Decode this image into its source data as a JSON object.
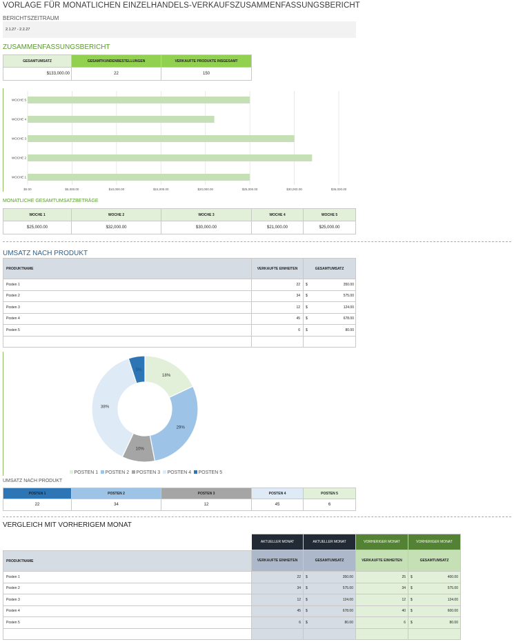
{
  "title": "VORLAGE FÜR MONATLICHEN EINZELHANDELS-VERKAUFSZUSAMMENFASSUNGSBERICHT",
  "period": {
    "label": "BERICHTSZEITRAUM",
    "value": "2.1.27 - 2.2.27"
  },
  "summary": {
    "heading": "ZUSAMMENFASSUNGSBERICHT",
    "headers": [
      "GESAMTUMSATZ",
      "GESAMTKUNDENBESTELLUNGEN",
      "VERKAUFTE PRODUKTE INSGESAMT"
    ],
    "values": [
      "$133,000.00",
      "22",
      "150"
    ]
  },
  "weekly": {
    "heading": "MONATLICHE GESAMTUMSATZBETRÄGE",
    "headers": [
      "WOCHE 1",
      "WOCHE 2",
      "WOCHE 3",
      "WOCHE 4",
      "WOCHE 5"
    ],
    "values": [
      "$25,000.00",
      "$32,000.00",
      "$30,000.00",
      "$21,000.00",
      "$25,000.00"
    ]
  },
  "product": {
    "heading": "UMSATZ NACH PRODUKT",
    "col_name": "PRODUKTNAME",
    "col_units": "VERKAUFTE EINHEITEN",
    "col_total": "GESAMTUMSATZ",
    "currency": "$",
    "rows": [
      {
        "name": "Posten 1",
        "units": "22",
        "total": "350.00"
      },
      {
        "name": "Posten 2",
        "units": "34",
        "total": "575.00"
      },
      {
        "name": "Posten 3",
        "units": "12",
        "total": "124.00"
      },
      {
        "name": "Posten 4",
        "units": "45",
        "total": "678.00"
      },
      {
        "name": "Posten 5",
        "units": "6",
        "total": "80.00"
      }
    ]
  },
  "units_table": {
    "heading": "UMSATZ NACH PRODUKT",
    "headers": [
      "POSTEN 1",
      "POSTEN 2",
      "POSTEN 3",
      "POSTEN 4",
      "POSTEN 5"
    ],
    "values": [
      "22",
      "34",
      "12",
      "45",
      "6"
    ]
  },
  "comparison": {
    "heading": "VERGLEICH MIT VORHERIGEM MONAT",
    "top_headers": [
      "AKTUELLER MONAT",
      "AKTUELLER MONAT",
      "VORHERIGER MONAT",
      "VORHERIGER MONAT"
    ],
    "col_name": "PRODUKTNAME",
    "sub_headers": [
      "VERKAUFTE EINHEITEN",
      "GESAMTUMSATZ",
      "VERKAUFTE EINHEITEN",
      "GESAMTUMSATZ"
    ],
    "currency": "$",
    "rows": [
      {
        "name": "Posten 1",
        "cu": "22",
        "ct": "350.00",
        "pu": "25",
        "pt": "400.00"
      },
      {
        "name": "Posten 2",
        "cu": "34",
        "ct": "575.00",
        "pu": "34",
        "pt": "575.00"
      },
      {
        "name": "Posten 3",
        "cu": "12",
        "ct": "124.00",
        "pu": "12",
        "pt": "124.00"
      },
      {
        "name": "Posten 4",
        "cu": "45",
        "ct": "678.00",
        "pu": "40",
        "pt": "600.00"
      },
      {
        "name": "Posten 5",
        "cu": "6",
        "ct": "80.00",
        "pu": "6",
        "pt": "80.00"
      }
    ]
  },
  "colors": {
    "green_light": "#e2efd9",
    "green_mid": "#92d050",
    "green_bar": "#c5e0b4",
    "navy": "#222a35",
    "dark_green": "#548235",
    "table_header": "#d6dce4",
    "blue_dark": "#2e75b6",
    "blue_light": "#9dc3e6",
    "gray": "#a5a5a5",
    "blue_pale": "#deebf7"
  },
  "chart_data": [
    {
      "type": "bar",
      "orientation": "horizontal",
      "categories": [
        "WOCHE 1",
        "WOCHE 2",
        "WOCHE 3",
        "WOCHE 4",
        "WOCHE 5"
      ],
      "values": [
        25000,
        32000,
        30000,
        21000,
        25000
      ],
      "xlim": [
        0,
        35000
      ],
      "xticks": [
        "$0.00",
        "$5,000.00",
        "$10,000.00",
        "$15,000.00",
        "$20,000.00",
        "$25,000.00",
        "$30,000.00",
        "$35,000.00"
      ],
      "grid": true
    },
    {
      "type": "pie",
      "donut": true,
      "categories": [
        "POSTEN 1",
        "POSTEN 2",
        "POSTEN 3",
        "POSTEN 4",
        "POSTEN 5"
      ],
      "values": [
        18,
        29,
        10,
        38,
        5
      ],
      "labels": [
        "18%",
        "29%",
        "10%",
        "38%",
        "5%"
      ],
      "colors": [
        "#e2efd9",
        "#9dc3e6",
        "#a5a5a5",
        "#deebf7",
        "#2e75b6"
      ],
      "legend": "bottom"
    }
  ]
}
